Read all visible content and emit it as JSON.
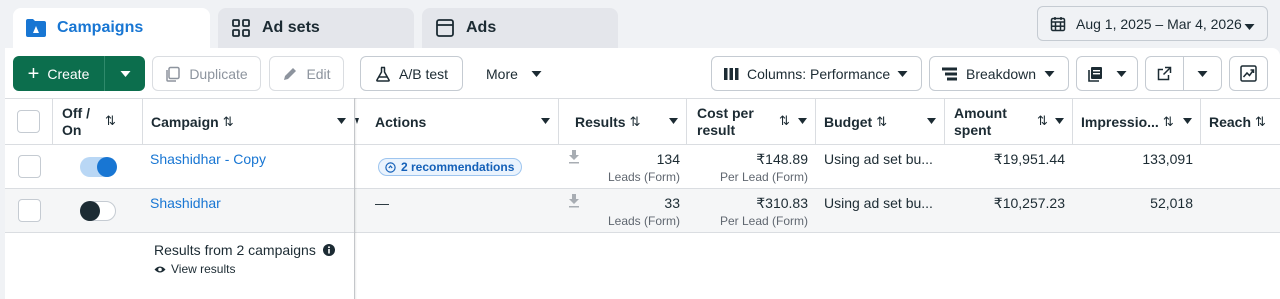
{
  "tabs": [
    {
      "label": "Campaigns",
      "icon": "folder-flag-icon",
      "active": true
    },
    {
      "label": "Ad sets",
      "icon": "grid-icon",
      "active": false
    },
    {
      "label": "Ads",
      "icon": "window-icon",
      "active": false
    }
  ],
  "date_range": "Aug 1, 2025 – Mar 4, 2026",
  "toolbar": {
    "create": "Create",
    "duplicate": "Duplicate",
    "edit": "Edit",
    "ab_test": "A/B test",
    "more": "More",
    "columns": "Columns: Performance",
    "breakdown": "Breakdown"
  },
  "columns": {
    "off_on_1": "Off /",
    "off_on_2": "On",
    "campaign": "Campaign",
    "actions": "Actions",
    "results": "Results",
    "cost_1": "Cost per",
    "cost_2": "result",
    "budget": "Budget",
    "amount_1": "Amount",
    "amount_2": "spent",
    "impressions": "Impressio...",
    "reach": "Reach"
  },
  "rows": [
    {
      "enabled": true,
      "campaign": "Shashidhar - Copy",
      "actions": "2 recommendations",
      "results": "134",
      "results_sub": "Leads (Form)",
      "cost": "₹148.89",
      "cost_sub": "Per Lead (Form)",
      "budget": "Using ad set bu...",
      "amount": "₹19,951.44",
      "impressions": "133,091"
    },
    {
      "enabled": false,
      "campaign": "Shashidhar",
      "actions": "—",
      "results": "33",
      "results_sub": "Leads (Form)",
      "cost": "₹310.83",
      "cost_sub": "Per Lead (Form)",
      "budget": "Using ad set bu...",
      "amount": "₹10,257.23",
      "impressions": "52,018"
    }
  ],
  "footer": {
    "results_from": "Results from 2 campaigns",
    "view_results": "View results"
  },
  "colors": {
    "accent": "#1876d3",
    "create_green": "#0c6e4d"
  }
}
